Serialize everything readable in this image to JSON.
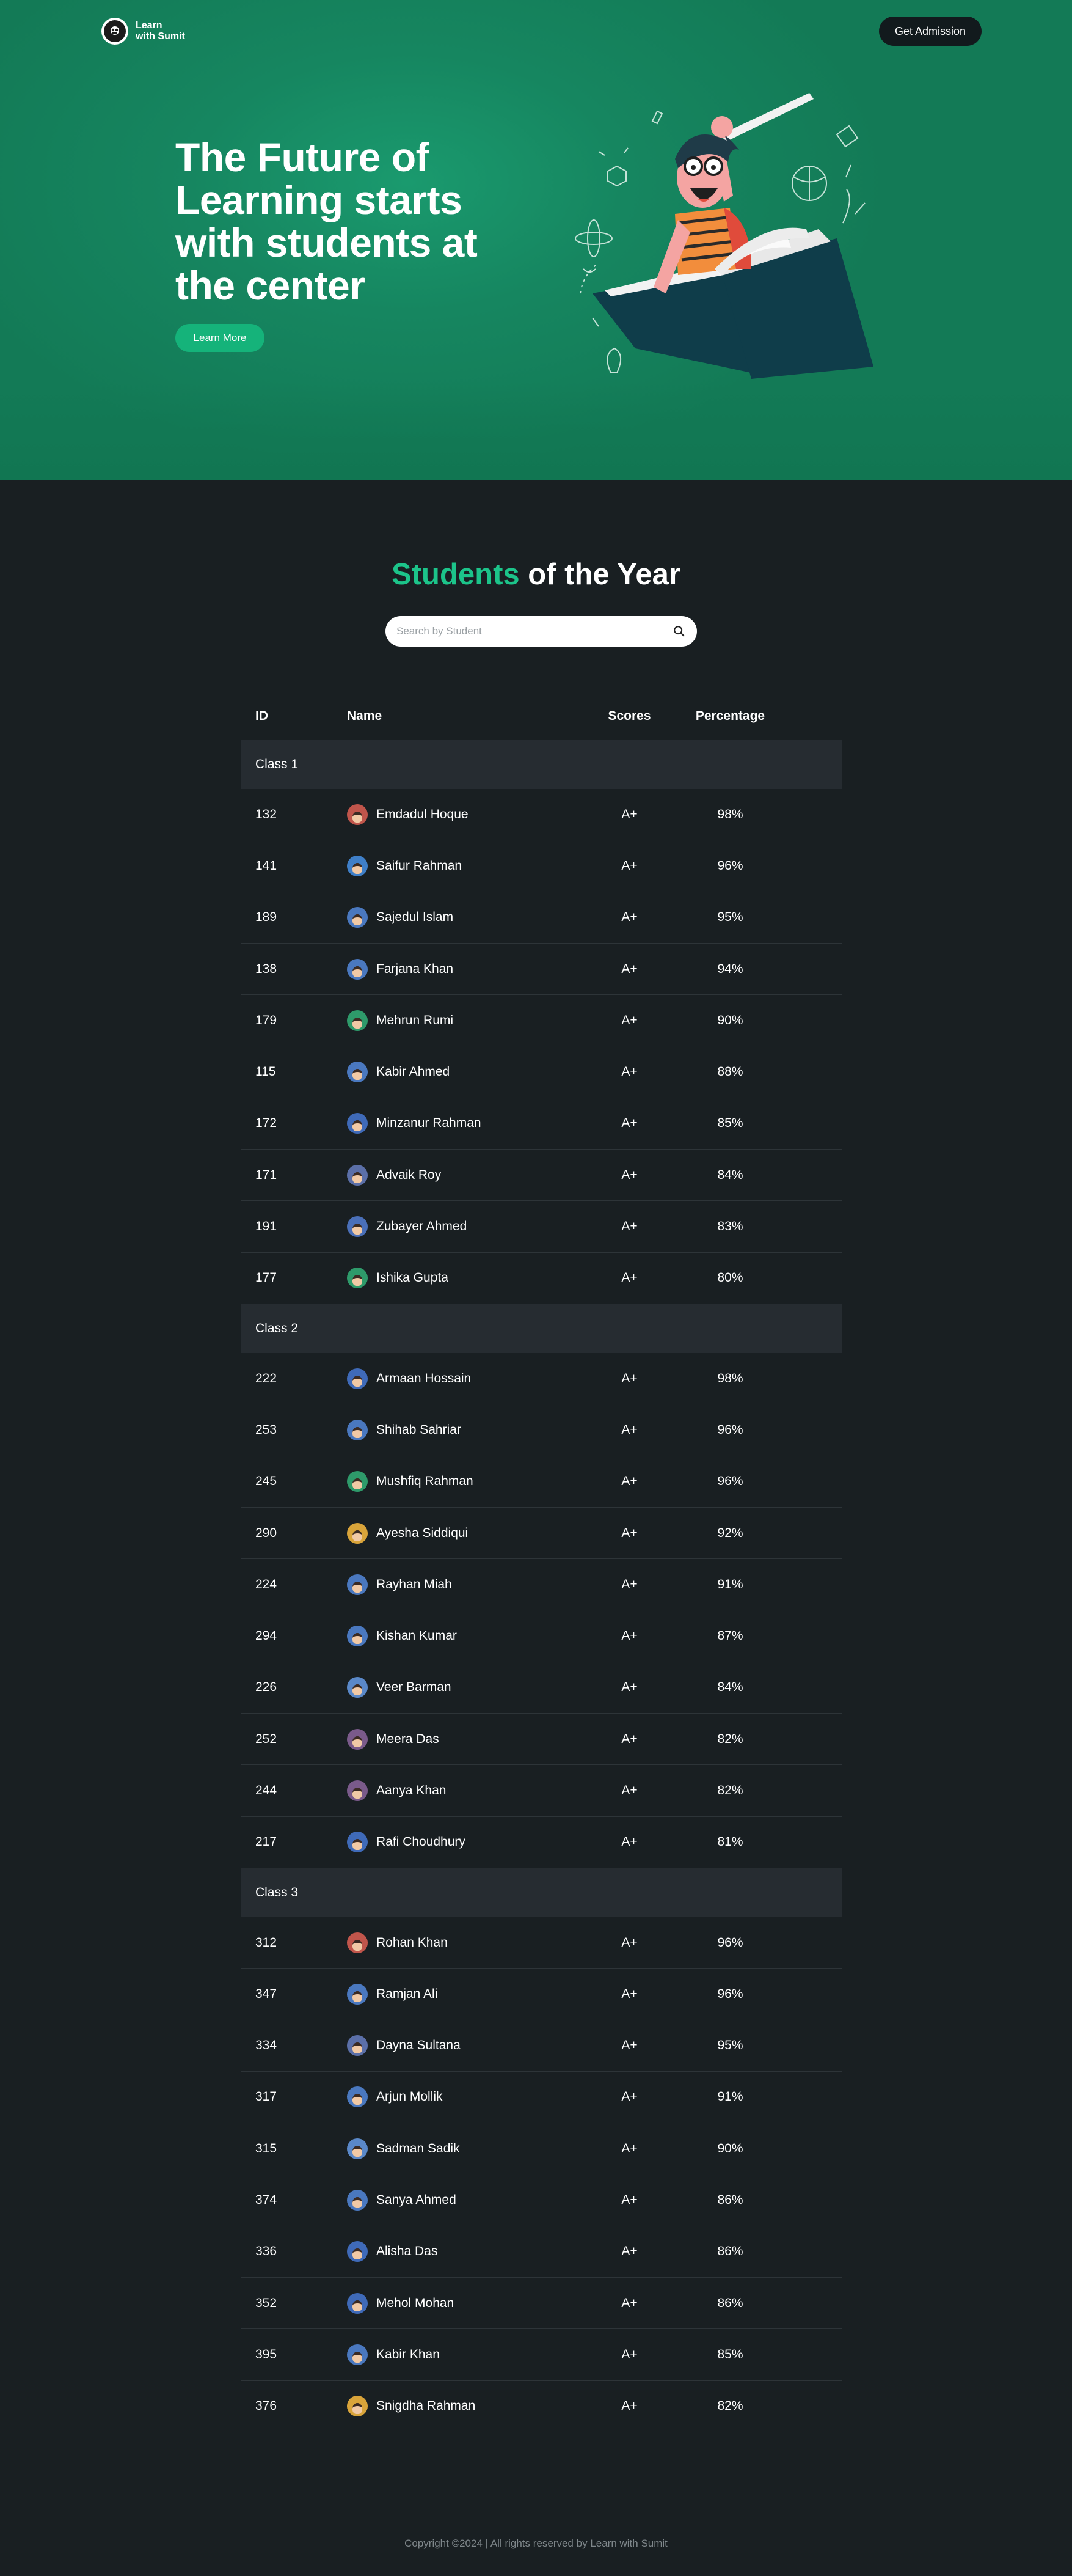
{
  "nav": {
    "logo_line1": "Learn",
    "logo_line2": "with Sumit",
    "admission_label": "Get Admission"
  },
  "hero": {
    "title": "The Future of Learning starts with students at the center",
    "cta_label": "Learn More"
  },
  "section": {
    "title_accent": "Students",
    "title_rest": " of the Year"
  },
  "search": {
    "placeholder": "Search by Student"
  },
  "table": {
    "headers": {
      "id": "ID",
      "name": "Name",
      "scores": "Scores",
      "percentage": "Percentage"
    },
    "classes": [
      {
        "label": "Class 1",
        "students": [
          {
            "id": "132",
            "name": "Emdadul Hoque",
            "score": "A+",
            "pct": "98%",
            "color": "#c0554b"
          },
          {
            "id": "141",
            "name": "Saifur Rahman",
            "score": "A+",
            "pct": "96%",
            "color": "#3f7fc8"
          },
          {
            "id": "189",
            "name": "Sajedul Islam",
            "score": "A+",
            "pct": "95%",
            "color": "#4a78bf"
          },
          {
            "id": "138",
            "name": "Farjana Khan",
            "score": "A+",
            "pct": "94%",
            "color": "#4a78bf"
          },
          {
            "id": "179",
            "name": "Mehrun Rumi",
            "score": "A+",
            "pct": "90%",
            "color": "#2e9a6a"
          },
          {
            "id": "115",
            "name": "Kabir Ahmed",
            "score": "A+",
            "pct": "88%",
            "color": "#4a78bf"
          },
          {
            "id": "172",
            "name": "Minzanur Rahman",
            "score": "A+",
            "pct": "85%",
            "color": "#3f6ab8"
          },
          {
            "id": "171",
            "name": "Advaik Roy",
            "score": "A+",
            "pct": "84%",
            "color": "#5b6fa8"
          },
          {
            "id": "191",
            "name": "Zubayer Ahmed",
            "score": "A+",
            "pct": "83%",
            "color": "#4a6fb8"
          },
          {
            "id": "177",
            "name": "Ishika Gupta",
            "score": "A+",
            "pct": "80%",
            "color": "#2e9a6a"
          }
        ]
      },
      {
        "label": "Class 2",
        "students": [
          {
            "id": "222",
            "name": "Armaan Hossain",
            "score": "A+",
            "pct": "98%",
            "color": "#3f6ab8"
          },
          {
            "id": "253",
            "name": "Shihab Sahriar",
            "score": "A+",
            "pct": "96%",
            "color": "#4a78bf"
          },
          {
            "id": "245",
            "name": "Mushfiq Rahman",
            "score": "A+",
            "pct": "96%",
            "color": "#2e9a6a"
          },
          {
            "id": "290",
            "name": "Ayesha Siddiqui",
            "score": "A+",
            "pct": "92%",
            "color": "#d9a43a"
          },
          {
            "id": "224",
            "name": "Rayhan Miah",
            "score": "A+",
            "pct": "91%",
            "color": "#4a78bf"
          },
          {
            "id": "294",
            "name": "Kishan Kumar",
            "score": "A+",
            "pct": "87%",
            "color": "#4a78bf"
          },
          {
            "id": "226",
            "name": "Veer Barman",
            "score": "A+",
            "pct": "84%",
            "color": "#5a88c8"
          },
          {
            "id": "252",
            "name": "Meera Das",
            "score": "A+",
            "pct": "82%",
            "color": "#7a5a8a"
          },
          {
            "id": "244",
            "name": "Aanya Khan",
            "score": "A+",
            "pct": "82%",
            "color": "#7a5a8a"
          },
          {
            "id": "217",
            "name": "Rafi Choudhury",
            "score": "A+",
            "pct": "81%",
            "color": "#3f6ab8"
          }
        ]
      },
      {
        "label": "Class 3",
        "students": [
          {
            "id": "312",
            "name": "Rohan Khan",
            "score": "A+",
            "pct": "96%",
            "color": "#c0554b"
          },
          {
            "id": "347",
            "name": "Ramjan Ali",
            "score": "A+",
            "pct": "96%",
            "color": "#4a78bf"
          },
          {
            "id": "334",
            "name": "Dayna Sultana",
            "score": "A+",
            "pct": "95%",
            "color": "#5b6fa8"
          },
          {
            "id": "317",
            "name": "Arjun Mollik",
            "score": "A+",
            "pct": "91%",
            "color": "#4a78bf"
          },
          {
            "id": "315",
            "name": "Sadman Sadik",
            "score": "A+",
            "pct": "90%",
            "color": "#5a88c8"
          },
          {
            "id": "374",
            "name": "Sanya Ahmed",
            "score": "A+",
            "pct": "86%",
            "color": "#4a78bf"
          },
          {
            "id": "336",
            "name": "Alisha Das",
            "score": "A+",
            "pct": "86%",
            "color": "#3f6ab8"
          },
          {
            "id": "352",
            "name": "Mehol Mohan",
            "score": "A+",
            "pct": "86%",
            "color": "#3f6ab8"
          },
          {
            "id": "395",
            "name": "Kabir Khan",
            "score": "A+",
            "pct": "85%",
            "color": "#4a78bf"
          },
          {
            "id": "376",
            "name": "Snigdha Rahman",
            "score": "A+",
            "pct": "82%",
            "color": "#d9a43a"
          }
        ]
      }
    ]
  },
  "footer": {
    "text": "Copyright ©2024 | All rights reserved by Learn with Sumit"
  },
  "colors": {
    "accent": "#1cc48a",
    "hero_bg": "#168660",
    "page_bg": "#191f22",
    "class_row_bg": "#262c31"
  },
  "icons": {
    "search": "search-icon",
    "logo": "logo-icon"
  }
}
